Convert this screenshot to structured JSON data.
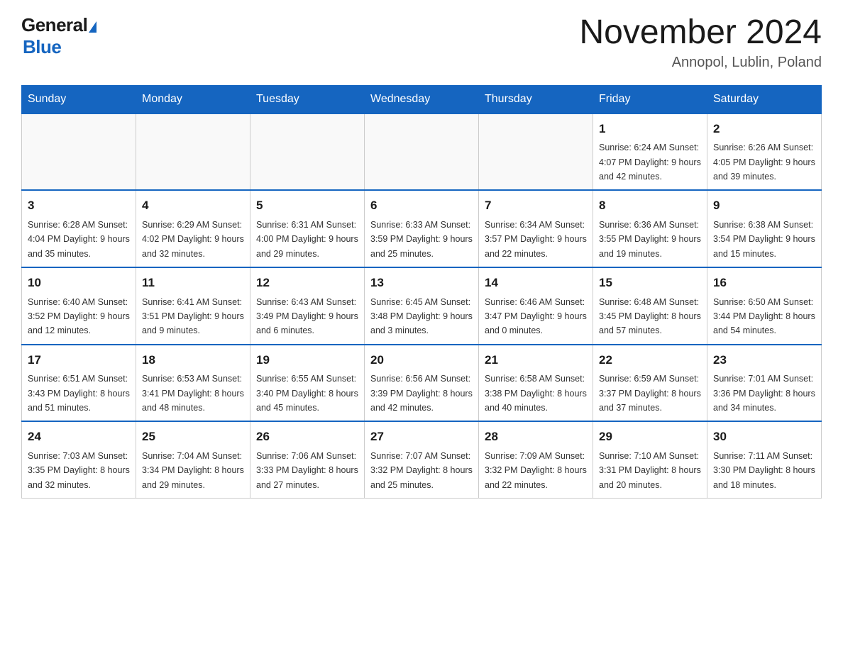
{
  "header": {
    "logo_general": "General",
    "logo_blue": "Blue",
    "title": "November 2024",
    "subtitle": "Annopol, Lublin, Poland"
  },
  "weekdays": [
    "Sunday",
    "Monday",
    "Tuesday",
    "Wednesday",
    "Thursday",
    "Friday",
    "Saturday"
  ],
  "weeks": [
    [
      {
        "day": "",
        "info": ""
      },
      {
        "day": "",
        "info": ""
      },
      {
        "day": "",
        "info": ""
      },
      {
        "day": "",
        "info": ""
      },
      {
        "day": "",
        "info": ""
      },
      {
        "day": "1",
        "info": "Sunrise: 6:24 AM\nSunset: 4:07 PM\nDaylight: 9 hours and 42 minutes."
      },
      {
        "day": "2",
        "info": "Sunrise: 6:26 AM\nSunset: 4:05 PM\nDaylight: 9 hours and 39 minutes."
      }
    ],
    [
      {
        "day": "3",
        "info": "Sunrise: 6:28 AM\nSunset: 4:04 PM\nDaylight: 9 hours and 35 minutes."
      },
      {
        "day": "4",
        "info": "Sunrise: 6:29 AM\nSunset: 4:02 PM\nDaylight: 9 hours and 32 minutes."
      },
      {
        "day": "5",
        "info": "Sunrise: 6:31 AM\nSunset: 4:00 PM\nDaylight: 9 hours and 29 minutes."
      },
      {
        "day": "6",
        "info": "Sunrise: 6:33 AM\nSunset: 3:59 PM\nDaylight: 9 hours and 25 minutes."
      },
      {
        "day": "7",
        "info": "Sunrise: 6:34 AM\nSunset: 3:57 PM\nDaylight: 9 hours and 22 minutes."
      },
      {
        "day": "8",
        "info": "Sunrise: 6:36 AM\nSunset: 3:55 PM\nDaylight: 9 hours and 19 minutes."
      },
      {
        "day": "9",
        "info": "Sunrise: 6:38 AM\nSunset: 3:54 PM\nDaylight: 9 hours and 15 minutes."
      }
    ],
    [
      {
        "day": "10",
        "info": "Sunrise: 6:40 AM\nSunset: 3:52 PM\nDaylight: 9 hours and 12 minutes."
      },
      {
        "day": "11",
        "info": "Sunrise: 6:41 AM\nSunset: 3:51 PM\nDaylight: 9 hours and 9 minutes."
      },
      {
        "day": "12",
        "info": "Sunrise: 6:43 AM\nSunset: 3:49 PM\nDaylight: 9 hours and 6 minutes."
      },
      {
        "day": "13",
        "info": "Sunrise: 6:45 AM\nSunset: 3:48 PM\nDaylight: 9 hours and 3 minutes."
      },
      {
        "day": "14",
        "info": "Sunrise: 6:46 AM\nSunset: 3:47 PM\nDaylight: 9 hours and 0 minutes."
      },
      {
        "day": "15",
        "info": "Sunrise: 6:48 AM\nSunset: 3:45 PM\nDaylight: 8 hours and 57 minutes."
      },
      {
        "day": "16",
        "info": "Sunrise: 6:50 AM\nSunset: 3:44 PM\nDaylight: 8 hours and 54 minutes."
      }
    ],
    [
      {
        "day": "17",
        "info": "Sunrise: 6:51 AM\nSunset: 3:43 PM\nDaylight: 8 hours and 51 minutes."
      },
      {
        "day": "18",
        "info": "Sunrise: 6:53 AM\nSunset: 3:41 PM\nDaylight: 8 hours and 48 minutes."
      },
      {
        "day": "19",
        "info": "Sunrise: 6:55 AM\nSunset: 3:40 PM\nDaylight: 8 hours and 45 minutes."
      },
      {
        "day": "20",
        "info": "Sunrise: 6:56 AM\nSunset: 3:39 PM\nDaylight: 8 hours and 42 minutes."
      },
      {
        "day": "21",
        "info": "Sunrise: 6:58 AM\nSunset: 3:38 PM\nDaylight: 8 hours and 40 minutes."
      },
      {
        "day": "22",
        "info": "Sunrise: 6:59 AM\nSunset: 3:37 PM\nDaylight: 8 hours and 37 minutes."
      },
      {
        "day": "23",
        "info": "Sunrise: 7:01 AM\nSunset: 3:36 PM\nDaylight: 8 hours and 34 minutes."
      }
    ],
    [
      {
        "day": "24",
        "info": "Sunrise: 7:03 AM\nSunset: 3:35 PM\nDaylight: 8 hours and 32 minutes."
      },
      {
        "day": "25",
        "info": "Sunrise: 7:04 AM\nSunset: 3:34 PM\nDaylight: 8 hours and 29 minutes."
      },
      {
        "day": "26",
        "info": "Sunrise: 7:06 AM\nSunset: 3:33 PM\nDaylight: 8 hours and 27 minutes."
      },
      {
        "day": "27",
        "info": "Sunrise: 7:07 AM\nSunset: 3:32 PM\nDaylight: 8 hours and 25 minutes."
      },
      {
        "day": "28",
        "info": "Sunrise: 7:09 AM\nSunset: 3:32 PM\nDaylight: 8 hours and 22 minutes."
      },
      {
        "day": "29",
        "info": "Sunrise: 7:10 AM\nSunset: 3:31 PM\nDaylight: 8 hours and 20 minutes."
      },
      {
        "day": "30",
        "info": "Sunrise: 7:11 AM\nSunset: 3:30 PM\nDaylight: 8 hours and 18 minutes."
      }
    ]
  ]
}
